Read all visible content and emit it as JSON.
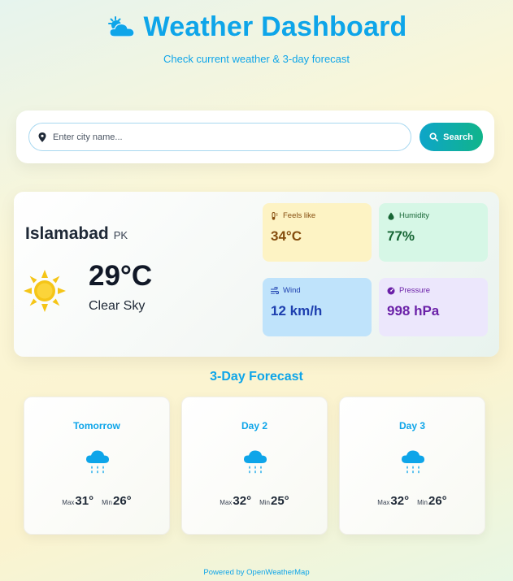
{
  "header": {
    "title": "Weather Dashboard",
    "subtitle": "Check current weather & 3-day forecast",
    "icon": "sun-behind-cloud-icon"
  },
  "search": {
    "placeholder": "Enter city name...",
    "value": "",
    "button_label": "Search"
  },
  "current": {
    "city": "Islamabad",
    "country": "PK",
    "temperature": "29°C",
    "condition": "Clear Sky",
    "icon": "sun-icon",
    "stats": {
      "feels_like": {
        "label": "Feels like",
        "value": "34°C",
        "icon": "thermometer-icon"
      },
      "humidity": {
        "label": "Humidity",
        "value": "77%",
        "icon": "droplet-icon"
      },
      "wind": {
        "label": "Wind",
        "value": "12 km/h",
        "icon": "wind-icon"
      },
      "pressure": {
        "label": "Pressure",
        "value": "998 hPa",
        "icon": "gauge-icon"
      }
    }
  },
  "forecast": {
    "title": "3-Day Forecast",
    "days": [
      {
        "day": "Tomorrow",
        "icon": "rain-cloud-icon",
        "max_label": "Max",
        "max": "31°",
        "min_label": "Min",
        "min": "26°"
      },
      {
        "day": "Day 2",
        "icon": "rain-cloud-icon",
        "max_label": "Max",
        "max": "32°",
        "min_label": "Min",
        "min": "25°"
      },
      {
        "day": "Day 3",
        "icon": "rain-cloud-icon",
        "max_label": "Max",
        "max": "32°",
        "min_label": "Min",
        "min": "26°"
      }
    ]
  },
  "footer": {
    "text": "Powered by OpenWeatherMap"
  },
  "colors": {
    "accent": "#0ea5e9",
    "search_gradient_start": "#0ea5c9",
    "search_gradient_end": "#10b48a",
    "feels_bg": "#fdf3c4",
    "humidity_bg": "#d6f7e6",
    "wind_bg": "#bfe3fb",
    "pressure_bg": "#ece7fc"
  }
}
